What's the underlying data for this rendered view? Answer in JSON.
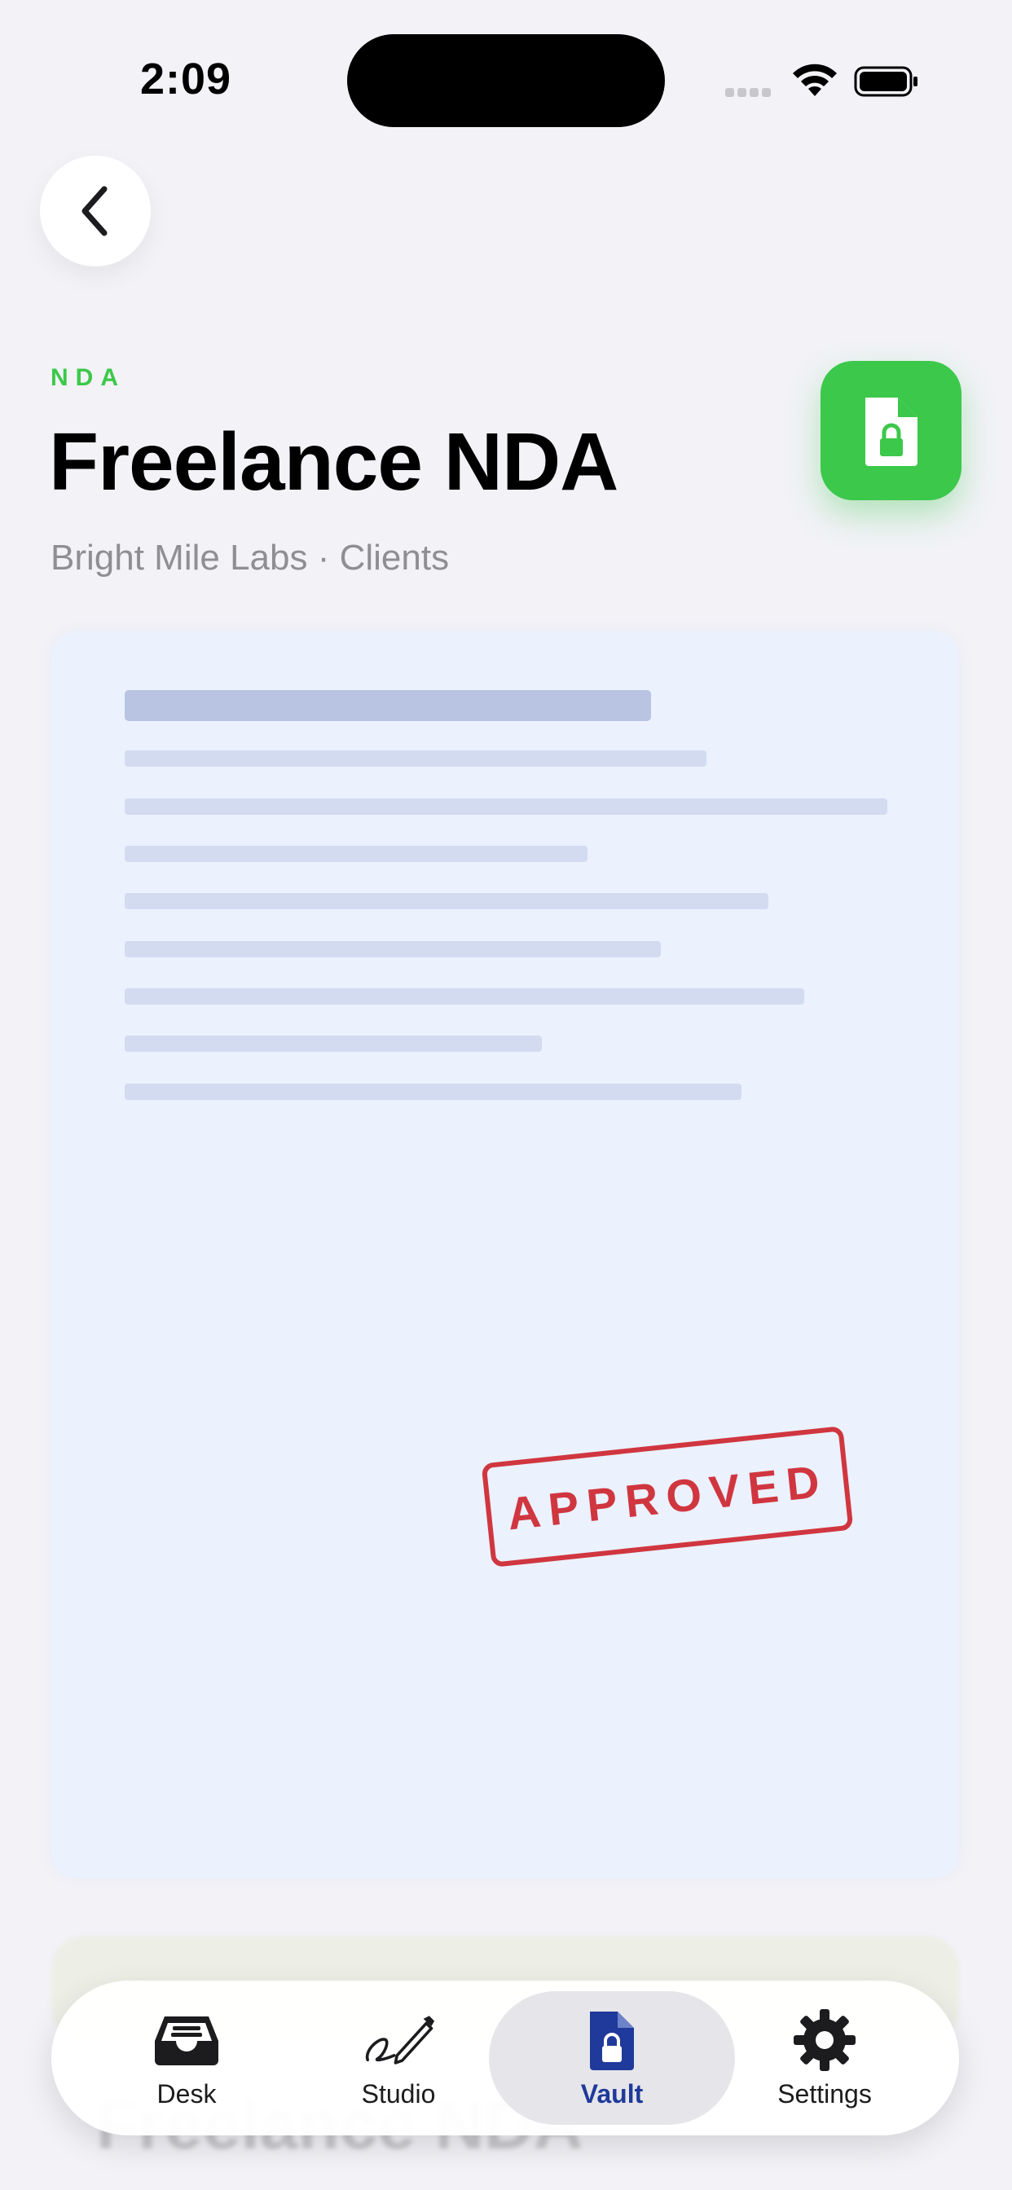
{
  "status_bar": {
    "time": "2:09"
  },
  "header": {
    "category": "NDA",
    "title": "Freelance NDA",
    "subtitle": "Bright Mile Labs · Clients"
  },
  "document": {
    "stamp_text": "APPROVED"
  },
  "tabs": [
    {
      "label": "Desk",
      "icon": "inbox-tray-icon"
    },
    {
      "label": "Studio",
      "icon": "signature-pen-icon"
    },
    {
      "label": "Vault",
      "icon": "locked-document-icon",
      "active": true
    },
    {
      "label": "Settings",
      "icon": "gear-icon"
    }
  ],
  "colors": {
    "accent_green": "#3cc84a",
    "active_tab": "#1f3a9a",
    "stamp_red": "#d0363f",
    "document_bg": "#ebf1fd"
  }
}
